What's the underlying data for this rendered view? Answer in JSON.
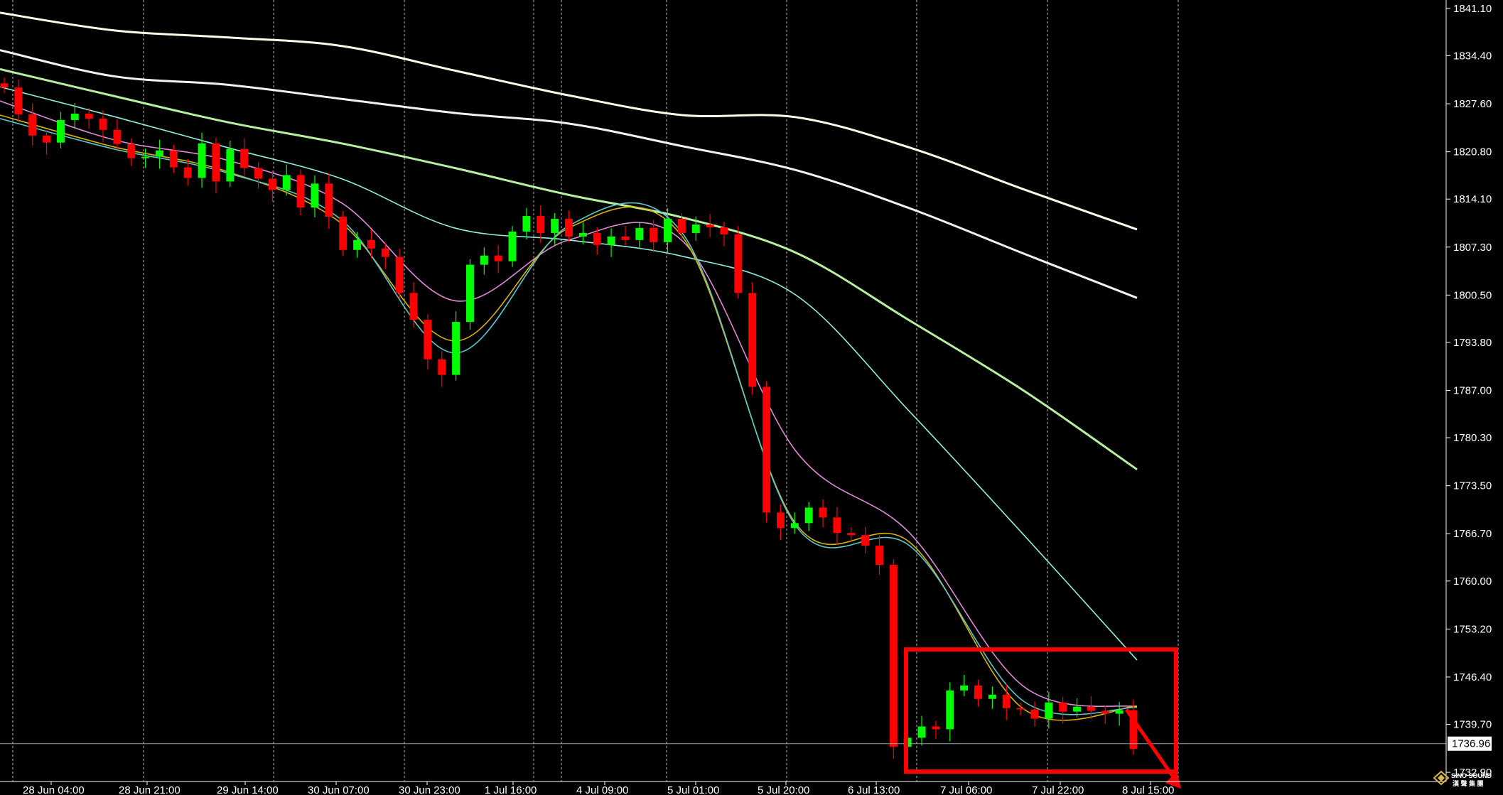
{
  "chart_data": {
    "type": "candlestick",
    "title": "",
    "background": "#000000",
    "grid": "vertical-dashed",
    "colors": {
      "bull_candle": "#00ff00",
      "bear_candle": "#ff0000",
      "axis_text": "#ffffff",
      "highlight_box": "#ff0000",
      "price_line": "#9aa3b0",
      "ma_yellow": "#d9b400",
      "ma_cyan": "#5ac8c8",
      "ma_pink": "#e08ad8",
      "ma_lightcyan": "#8ff0e0",
      "ma_lightgreen": "#b5f0a0",
      "ma_white": "#f2f2f2",
      "ma_ivory": "#fffde8"
    },
    "y_axis": {
      "ticks": [
        "1841.10",
        "1834.40",
        "1827.60",
        "1820.80",
        "1814.10",
        "1807.30",
        "1800.50",
        "1793.80",
        "1787.00",
        "1780.30",
        "1773.50",
        "1766.70",
        "1760.00",
        "1753.20",
        "1746.40",
        "1739.70",
        "1732.90"
      ],
      "range": [
        1731.6,
        1842.3
      ]
    },
    "x_axis": {
      "ticks": [
        "28 Jun 04:00",
        "28 Jun 21:00",
        "29 Jun 14:00",
        "30 Jun 07:00",
        "30 Jun 23:00",
        "1 Jul 16:00",
        "4 Jul 09:00",
        "5 Jul 01:00",
        "5 Jul 20:00",
        "6 Jul 13:00",
        "7 Jul 06:00",
        "7 Jul 22:00",
        "8 Jul 15:00"
      ]
    },
    "current_price": "1736.96",
    "highlight_box": {
      "color": "#ff0000",
      "price_range": [
        1733.0,
        1750.3
      ],
      "time_range": [
        "6 Jul 13:00",
        "8 Jul 15:00"
      ]
    },
    "trend_arrow": {
      "color": "#ff0000",
      "direction": "down",
      "from_price": 1741.8
    },
    "candle_closes": [
      1829.9,
      1826.1,
      1823.1,
      1822.1,
      1825.3,
      1826.2,
      1825.5,
      1823.9,
      1821.9,
      1819.9,
      1820.1,
      1821.0,
      1818.6,
      1817.1,
      1822.0,
      1816.6,
      1821.2,
      1818.5,
      1817.0,
      1815.4,
      1817.5,
      1812.9,
      1816.3,
      1811.6,
      1806.9,
      1808.3,
      1807.1,
      1805.9,
      1800.8,
      1797.0,
      1791.4,
      1789.2,
      1796.7,
      1804.8,
      1806.1,
      1805.3,
      1809.5,
      1811.7,
      1809.3,
      1811.3,
      1808.8,
      1809.3,
      1807.6,
      1808.8,
      1808.3,
      1810.0,
      1808.0,
      1811.3,
      1809.3,
      1810.5,
      1810.1,
      1809.1,
      1800.8,
      1787.5,
      1769.7,
      1767.5,
      1768.2,
      1770.4,
      1769.0,
      1766.8,
      1766.5,
      1765.0,
      1762.3,
      1736.5,
      1737.8,
      1739.4,
      1739.0,
      1744.5,
      1745.2,
      1743.3,
      1743.9,
      1742.0,
      1741.8,
      1740.5,
      1742.8,
      1741.5,
      1742.2,
      1741.6,
      1741.2,
      1741.7,
      1736.2
    ],
    "moving_averages": [
      {
        "color": "ma_ivory",
        "values": [
          1840.5,
          1838.0,
          1837.0,
          1835.8,
          1832.3,
          1828.8,
          1826.0,
          1825.7,
          1821.4,
          1815.5,
          1809.8
        ]
      },
      {
        "color": "ma_white",
        "values": [
          1835.2,
          1831.5,
          1830.3,
          1828.3,
          1826.3,
          1824.8,
          1821.6,
          1818.2,
          1812.8,
          1806.4,
          1800.1
        ]
      },
      {
        "color": "ma_lightgreen",
        "values": [
          1832.5,
          1828.7,
          1825.0,
          1822.0,
          1818.5,
          1814.7,
          1811.5,
          1806.5,
          1796.9,
          1787.0,
          1775.8
        ]
      },
      {
        "color": "ma_lightcyan",
        "values": [
          1830.0,
          1825.8,
          1821.4,
          1817.0,
          1810.0,
          1808.3,
          1806.0,
          1800.5,
          1784.0,
          1766.6,
          1748.8
        ]
      },
      {
        "color": "ma_pink",
        "values": [
          1828.0,
          1822.5,
          1819.6,
          1813.6,
          1799.7,
          1808.3,
          1808.2,
          1778.4,
          1766.8,
          1745.1,
          1742.2
        ]
      },
      {
        "color": "ma_yellow",
        "values": [
          1826.0,
          1821.5,
          1818.0,
          1810.7,
          1794.0,
          1810.0,
          1808.8,
          1768.1,
          1765.5,
          1741.9,
          1742.3
        ]
      },
      {
        "color": "ma_cyan",
        "values": [
          1825.5,
          1821.2,
          1817.8,
          1811.2,
          1792.3,
          1810.3,
          1809.3,
          1767.8,
          1765.0,
          1743.0,
          1742.1
        ]
      }
    ]
  },
  "watermark": {
    "brand": "SINO SOUND",
    "sub": "漢 聲 集 團"
  }
}
